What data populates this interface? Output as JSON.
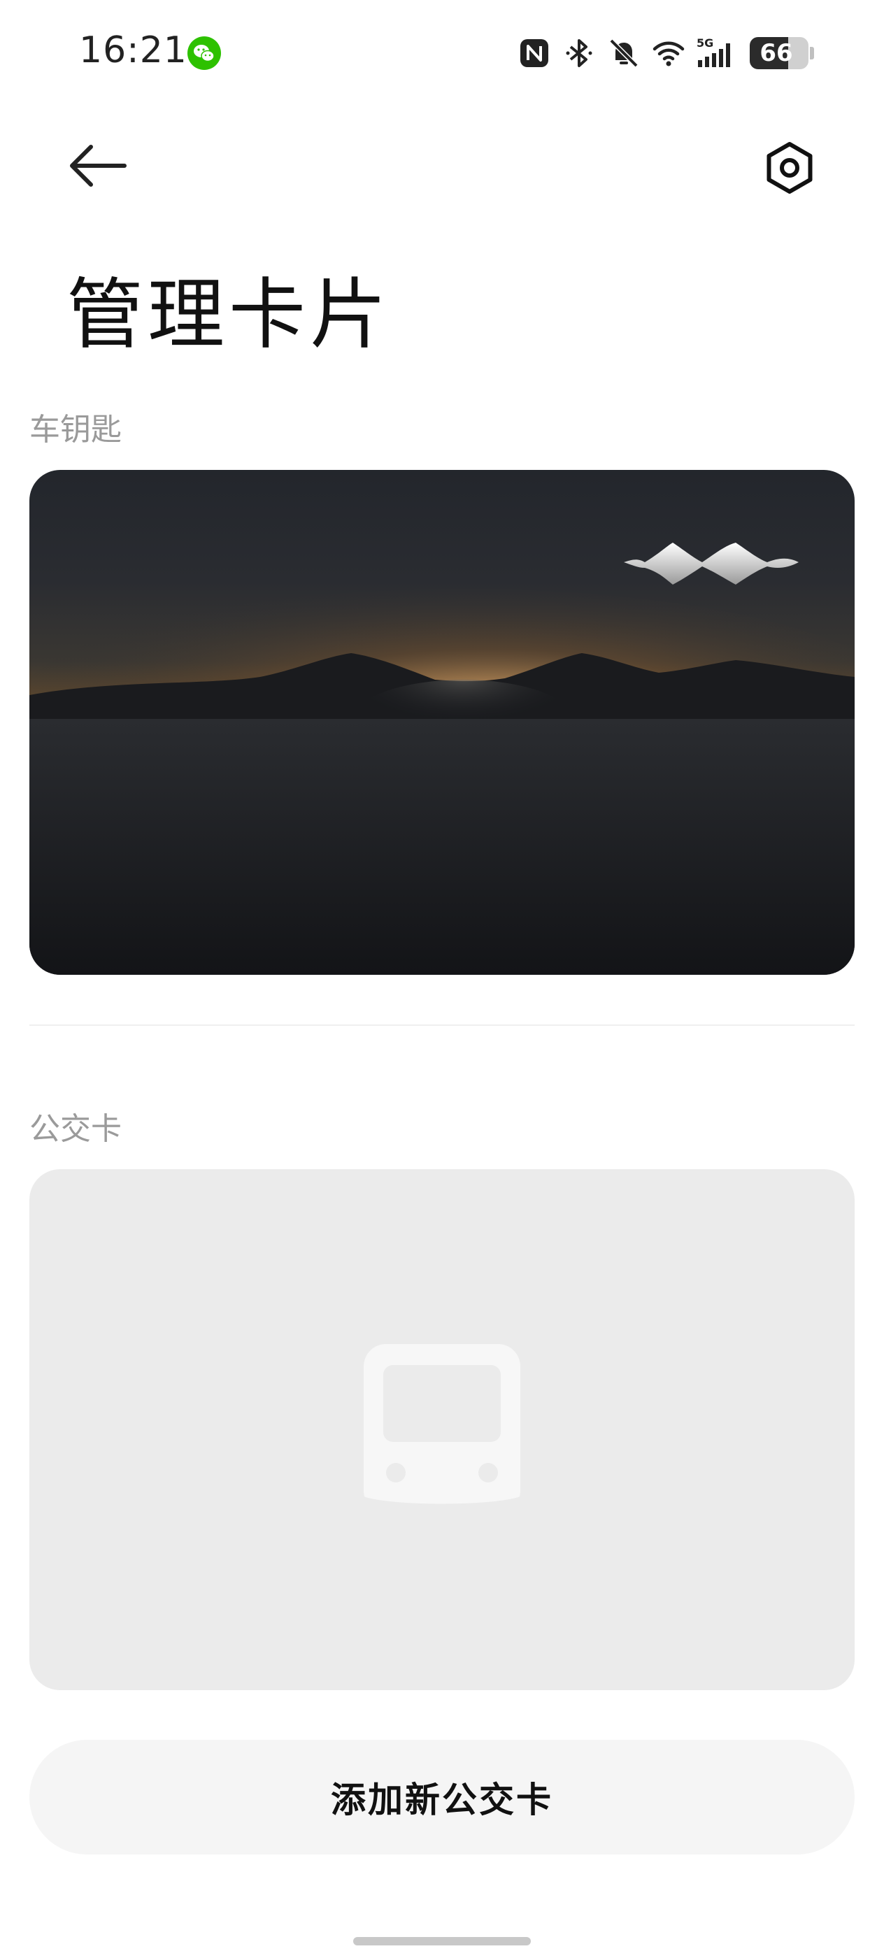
{
  "status_bar": {
    "time": "16:21",
    "network": "5G",
    "battery": "66",
    "battery_level": 0.66,
    "icons": [
      "wechat-icon",
      "nfc-icon",
      "bluetooth-icon",
      "silent-icon",
      "wifi-icon",
      "signal-icon",
      "battery-icon"
    ]
  },
  "header": {
    "title": "管理卡片",
    "back_icon": "arrow-left-icon",
    "settings_icon": "hexagon-settings-icon"
  },
  "sections": {
    "car_key": {
      "label": "车钥匙"
    },
    "transit": {
      "label": "公交卡"
    }
  },
  "actions": {
    "add_transit_card": "添加新公交卡"
  },
  "colors": {
    "accent_wechat": "#2dc100",
    "card_placeholder": "#ebebeb",
    "button_bg": "#f5f5f5"
  }
}
